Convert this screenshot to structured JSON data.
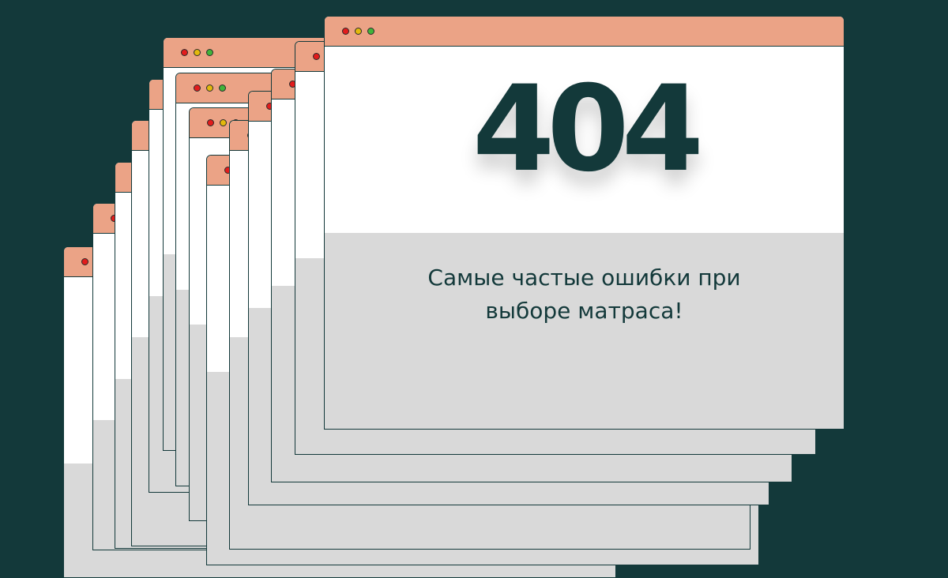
{
  "error_code": "404",
  "caption_line1": "Самые частые ошибки при",
  "caption_line2": "выборе матраса!",
  "colors": {
    "background": "#13393a",
    "titlebar": "#eba386",
    "page_top": "#ffffff",
    "page_bottom": "#d9d9d9",
    "dot_close": "#e21c1c",
    "dot_minimize": "#e3b90c",
    "dot_maximize": "#41b43a"
  }
}
